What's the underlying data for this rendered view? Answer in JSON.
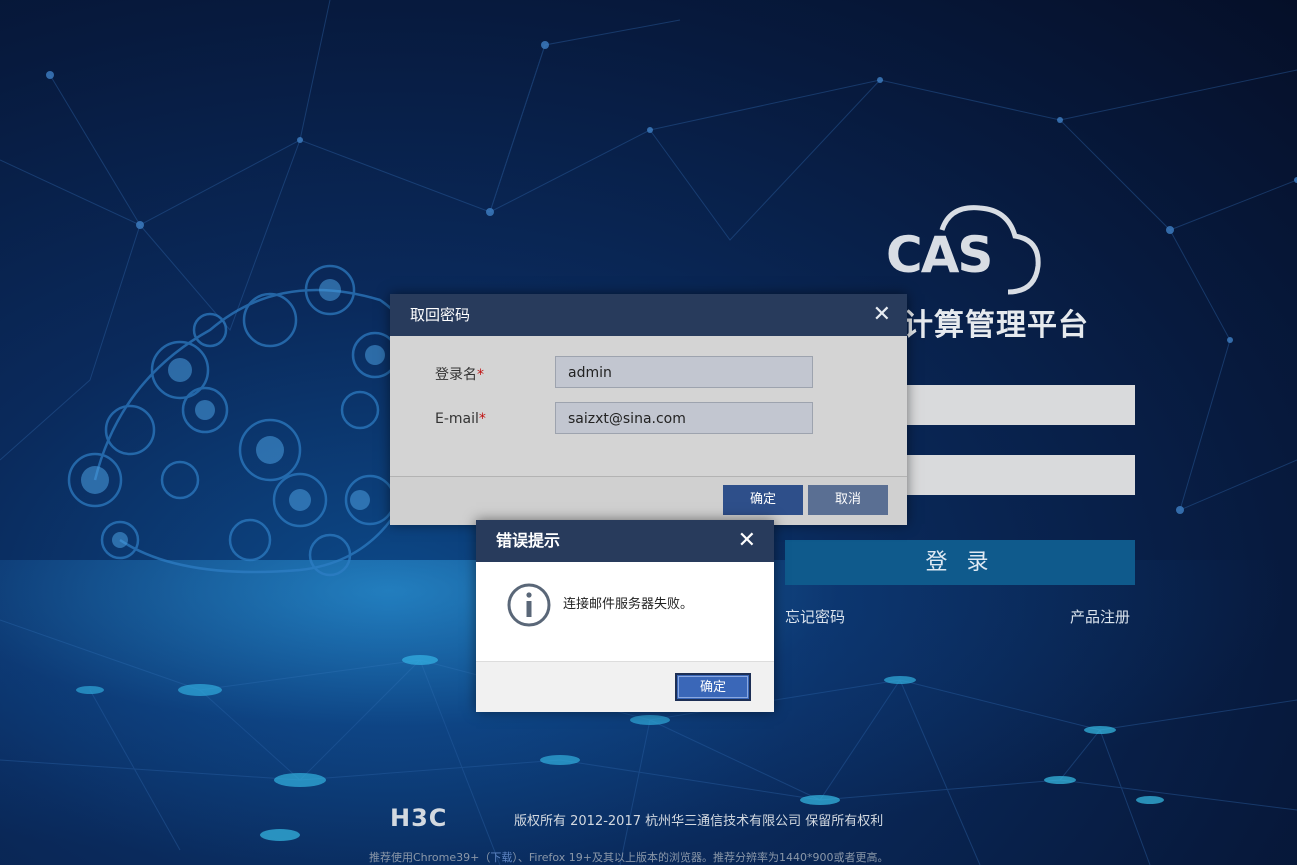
{
  "brand": {
    "logo_text": "CAS",
    "app_title": "计算管理平台",
    "footer_logo": "H3C",
    "copyright": "版权所有 2012-2017 杭州华三通信技术有限公司 保留所有权利",
    "browser_tip_prefix": "推荐使用Chrome39+（",
    "browser_tip_download": "下载",
    "browser_tip_suffix": "）、Firefox 19+及其以上版本的浏览器。推荐分辨率为1440*900或者更高。"
  },
  "login": {
    "login_button": "登 录",
    "forgot_password_link": "忘记密码",
    "product_register_link": "产品注册"
  },
  "retrieve_dialog": {
    "title": "取回密码",
    "username_label": "登录名",
    "username_value": "admin",
    "email_label": "E-mail",
    "email_value": "saizxt@sina.com",
    "required_mark": "*",
    "confirm_button": "确定",
    "cancel_button": "取消"
  },
  "error_dialog": {
    "title": "错误提示",
    "message": "连接邮件服务器失败。",
    "ok_button": "确定"
  },
  "icons": {
    "close": "close-icon",
    "info": "info-icon"
  },
  "colors": {
    "dialog_header": "#283b5c",
    "primary_button": "#3a67b8",
    "login_button": "#0f5a8c"
  }
}
